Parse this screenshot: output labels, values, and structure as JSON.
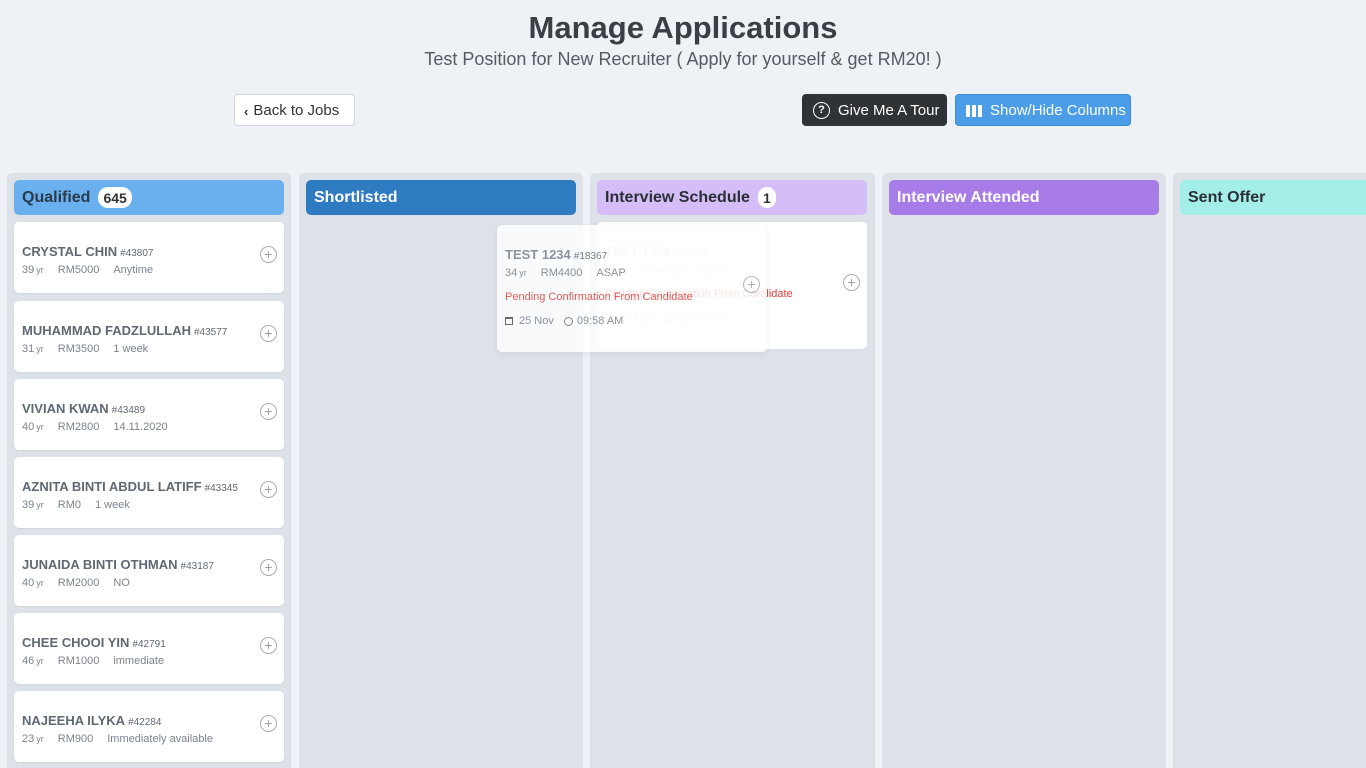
{
  "header": {
    "title": "Manage Applications",
    "subtitle": "Test Position for New Recruiter ( Apply for yourself & get RM20! )"
  },
  "toolbar": {
    "back_label": "Back to Jobs",
    "tour_label": "Give Me A Tour",
    "columns_label": "Show/Hide Columns"
  },
  "columns": [
    {
      "title": "Qualified",
      "count": "645",
      "color": "#6ab0ee"
    },
    {
      "title": "Shortlisted",
      "count": "",
      "color": "#2f7bc2"
    },
    {
      "title": "Interview Schedule",
      "count": "1",
      "color": "#d5bdf8"
    },
    {
      "title": "Interview Attended",
      "count": "",
      "color": "#a77be8"
    },
    {
      "title": "Sent Offer",
      "count": "",
      "color": "#a4eeea"
    }
  ],
  "qualified_cards": [
    {
      "name": "CRYSTAL CHIN",
      "id": "#43807",
      "age": "39",
      "yr": "yr",
      "salary": "RM5000",
      "availability": "Anytime"
    },
    {
      "name": "MUHAMMAD FADZLULLAH",
      "id": "#43577",
      "age": "31",
      "yr": "yr",
      "salary": "RM3500",
      "availability": "1 week"
    },
    {
      "name": "VIVIAN KWAN",
      "id": "#43489",
      "age": "40",
      "yr": "yr",
      "salary": "RM2800",
      "availability": "14.11.2020"
    },
    {
      "name": "AZNITA BINTI ABDUL LATIFF",
      "id": "#43345",
      "age": "39",
      "yr": "yr",
      "salary": "RM0",
      "availability": "1 week"
    },
    {
      "name": "JUNAIDA BINTI OTHMAN",
      "id": "#43187",
      "age": "40",
      "yr": "yr",
      "salary": "RM2000",
      "availability": "NO"
    },
    {
      "name": "CHEE CHOOI YIN",
      "id": "#42791",
      "age": "46",
      "yr": "yr",
      "salary": "RM1000",
      "availability": "immediate"
    },
    {
      "name": "NAJEEHA ILYKA",
      "id": "#42284",
      "age": "23",
      "yr": "yr",
      "salary": "RM900",
      "availability": "Immediately available"
    }
  ],
  "scheduled_card": {
    "name": "TEST 1234",
    "id": "#18367",
    "age": "34",
    "yr": "yr",
    "salary": "RM4400",
    "availability": "ASAP",
    "status": "Pending Confirmation From Candidate",
    "date": "25 Nov",
    "time": "09:58 AM"
  },
  "colors": {
    "page_bg": "#eef2f6",
    "column_bg": "#dce2e8",
    "status_red": "#e0403a",
    "tour_button": "#303336",
    "columns_button": "#4a9de6"
  }
}
